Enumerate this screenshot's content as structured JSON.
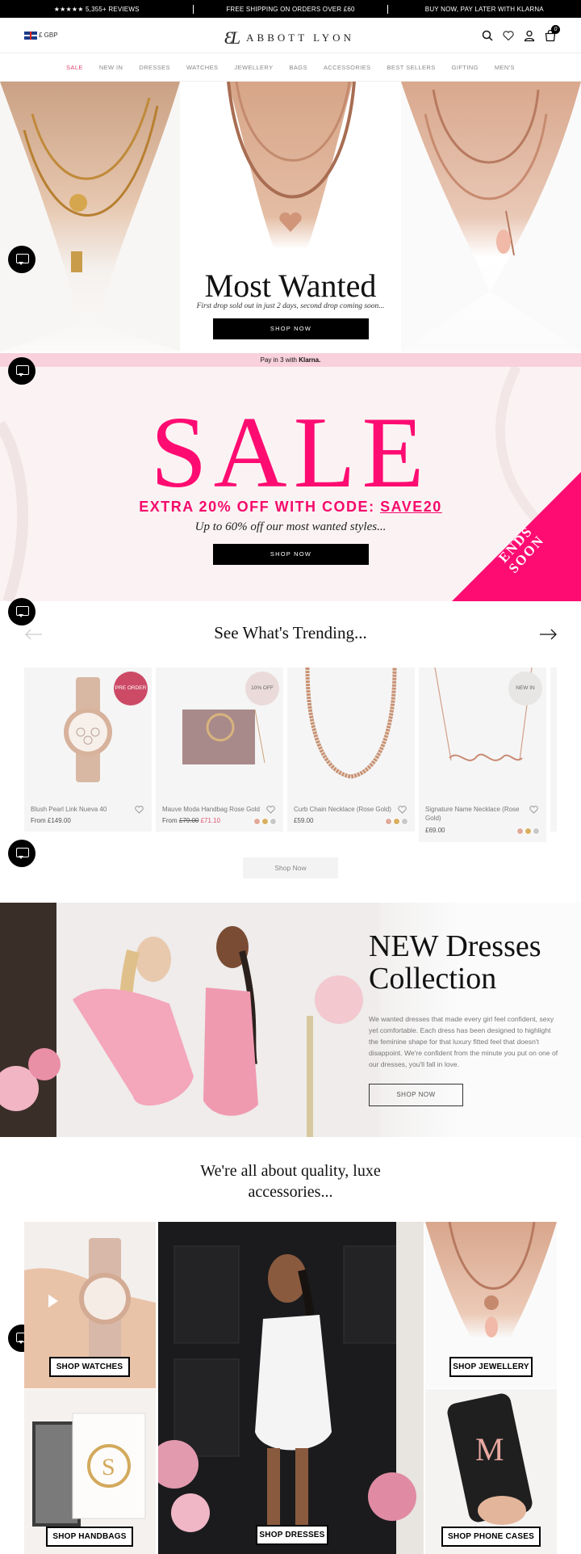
{
  "topbar": {
    "reviews": "★★★★★ 5,355+ REVIEWS",
    "shipping": "FREE SHIPPING ON ORDERS OVER £60",
    "paylater": "BUY NOW, PAY LATER WITH KLARNA"
  },
  "header": {
    "currency": "£ GBP",
    "logo_mark": "ƐL",
    "logo_text": "ABBOTT LYON",
    "cart_count": "0"
  },
  "nav": [
    "SALE",
    "NEW IN",
    "DRESSES",
    "WATCHES",
    "JEWELLERY",
    "BAGS",
    "ACCESSORIES",
    "BEST SELLERS",
    "GIFTING",
    "MEN'S"
  ],
  "hero": {
    "title": "Most Wanted",
    "subtitle": "First drop sold out in just 2 days, second drop coming soon...",
    "button": "SHOP NOW"
  },
  "klarna": {
    "text": "Pay in 3 with",
    "brand": "Klarna."
  },
  "sale": {
    "word": "SALE",
    "code_text": "EXTRA 20% OFF WITH CODE: ",
    "code": "SAVE20",
    "subtitle": "Up to 60% off our most wanted styles...",
    "button": "SHOP NOW",
    "ends": "ENDS",
    "soon": "SOON"
  },
  "trending": {
    "title": "See What's Trending...",
    "shop_now": "Shop Now",
    "products": [
      {
        "name": "Blush Pearl Link Nueva 40",
        "price": "From £149.00",
        "badge": "PRE ORDER"
      },
      {
        "name": "Mauve Moda Handbag Rose Gold",
        "price_from": "From",
        "old_price": "£79.00",
        "price": "£71.10",
        "badge": "10% OFF"
      },
      {
        "name": "Curb Chain Necklace (Rose Gold)",
        "price": "£59.00"
      },
      {
        "name": "Signature Name Necklace (Rose Gold)",
        "price": "£69.00",
        "badge": "NEW IN"
      }
    ]
  },
  "dresses": {
    "title_line1": "NEW Dresses",
    "title_line2": "Collection",
    "text": "We wanted dresses that made every girl feel confident, sexy yet comfortable. Each dress has been designed to highlight the feminine shape for that luxury fitted feel that doesn't disappoint. We're confident from the minute you put on one of our dresses, you'll fall in love.",
    "button": "SHOP NOW"
  },
  "quality": {
    "title_line1": "We're all about quality, luxe",
    "title_line2": "accessories...",
    "tiles": {
      "watches": "SHOP WATCHES",
      "jewellery": "SHOP JEWELLERY",
      "handbags": "SHOP HANDBAGS",
      "dresses": "SHOP DRESSES",
      "phone": "SHOP PHONE CASES"
    }
  },
  "colors": {
    "accent": "#ff0c72",
    "nav_sale": "#e24a74",
    "klarna_bg": "#f8d1dc"
  }
}
